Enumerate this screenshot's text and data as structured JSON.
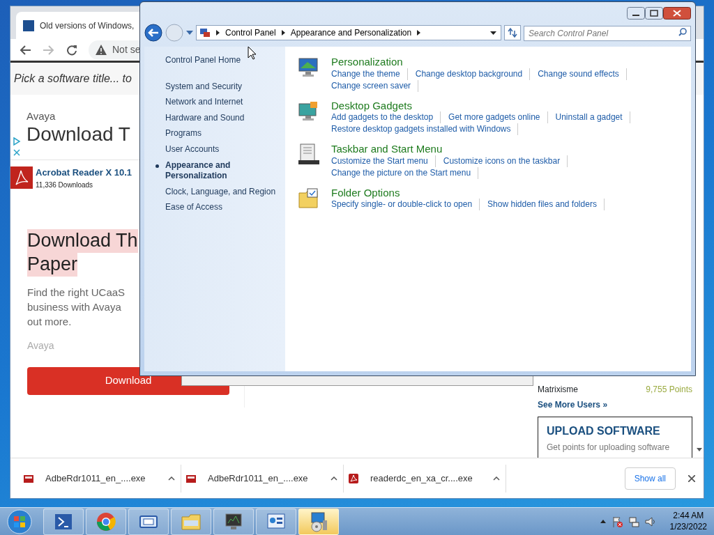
{
  "browser": {
    "tab_title": "Old versions of Windows,",
    "security_label": "Not se",
    "search_prompt": "Pick a software title... to",
    "ad_top": {
      "advertiser": "Avaya",
      "headline": "Download T"
    },
    "featured": {
      "title": "Acrobat Reader X 10.1",
      "downloads": "11,336 Downloads"
    },
    "ad_main": {
      "headline_lines": [
        "Download Th",
        "Paper"
      ],
      "body_lines": [
        "Find the right UCaaS",
        "business with Avaya",
        "out more."
      ],
      "advertiser": "Avaya",
      "button": "Download"
    },
    "top_users": [
      {
        "name": "Matrixisme",
        "points": "9,755 Points"
      }
    ],
    "see_more": "See More Users »",
    "upload": {
      "title": "UPLOAD SOFTWARE",
      "text": "Get points for uploading software"
    }
  },
  "downloads_bar": {
    "items": [
      {
        "filename": "AdbeRdr1011_en_....exe",
        "kind": "installer"
      },
      {
        "filename": "AdbeRdr1011_en_....exe",
        "kind": "installer"
      },
      {
        "filename": "readerdc_en_xa_cr....exe",
        "kind": "pdf"
      }
    ],
    "show_all": "Show all"
  },
  "control_panel": {
    "breadcrumbs": [
      "Control Panel",
      "Appearance and Personalization"
    ],
    "search_placeholder": "Search Control Panel",
    "sidebar": [
      {
        "label": "Control Panel Home",
        "kind": "home",
        "selected": false
      },
      {
        "label": "System and Security",
        "kind": "category",
        "selected": false
      },
      {
        "label": "Network and Internet",
        "kind": "category",
        "selected": false
      },
      {
        "label": "Hardware and Sound",
        "kind": "category",
        "selected": false
      },
      {
        "label": "Programs",
        "kind": "category",
        "selected": false
      },
      {
        "label": "User Accounts",
        "kind": "category",
        "selected": false
      },
      {
        "label": "Appearance and Personalization",
        "kind": "category",
        "selected": true
      },
      {
        "label": "Clock, Language, and Region",
        "kind": "category",
        "selected": false
      },
      {
        "label": "Ease of Access",
        "kind": "category",
        "selected": false
      }
    ],
    "categories": [
      {
        "title": "Personalization",
        "kind": "monitor",
        "links": [
          "Change the theme",
          "Change desktop background",
          "Change sound effects",
          "Change screen saver"
        ]
      },
      {
        "title": "Desktop Gadgets",
        "kind": "gadgets",
        "links": [
          "Add gadgets to the desktop",
          "Get more gadgets online",
          "Uninstall a gadget",
          "Restore desktop gadgets installed with Windows"
        ]
      },
      {
        "title": "Taskbar and Start Menu",
        "kind": "taskbar",
        "links": [
          "Customize the Start menu",
          "Customize icons on the taskbar",
          "Change the picture on the Start menu"
        ]
      },
      {
        "title": "Folder Options",
        "kind": "folder",
        "links": [
          "Specify single- or double-click to open",
          "Show hidden files and folders"
        ]
      }
    ]
  },
  "taskbar": {
    "clock": {
      "time": "2:44 AM",
      "date": "1/23/2022"
    }
  }
}
